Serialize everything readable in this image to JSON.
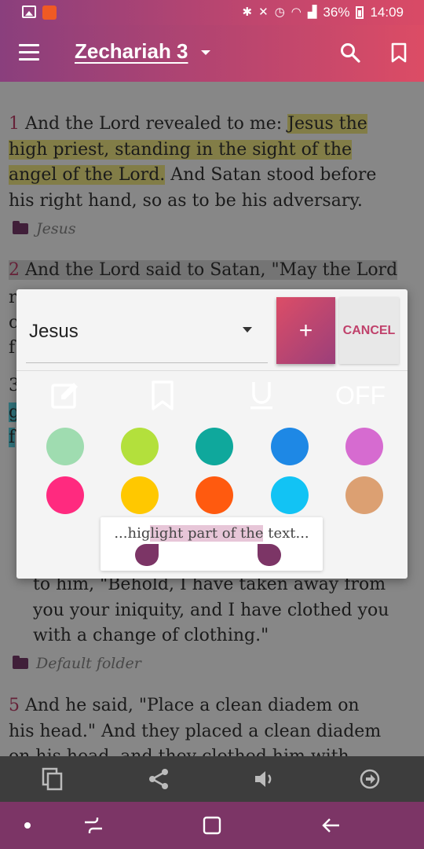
{
  "status_bar": {
    "battery": "36%",
    "time": "14:09"
  },
  "app_bar": {
    "title": "Zechariah 3"
  },
  "verses": [
    {
      "num": "1",
      "parts": [
        "And the Lord revealed to me: ",
        "Jesus the",
        "high priest, standing in the sight of the",
        "angel of the Lord.",
        " And Satan stood before",
        "his right hand, so as to be his adversary."
      ]
    },
    {
      "num": "2",
      "lines": [
        "And the Lord said to Satan, \"May the Lord"
      ]
    },
    {
      "num": "3"
    },
    {
      "lines": [
        "to him, \"Behold, I have taken away from",
        "you your iniquity, and I have clothed you",
        "with a change of clothing.\""
      ]
    },
    {
      "num": "5",
      "lines": [
        "And he said, \"Place a clean diadem on",
        "his head.\" And they placed a clean diadem",
        "on his head, and they clothed him with"
      ]
    }
  ],
  "folders": {
    "first": "Jesus",
    "second": "Default folder"
  },
  "fragments": {
    "r": "r",
    "c": "c",
    "f": "f",
    "g": "g",
    "f2": "f"
  },
  "popup": {
    "selected_folder": "Jesus",
    "add_label": "+",
    "cancel_label": "CANCEL",
    "off_label": "OFF",
    "preview_before": "...hig",
    "preview_highlight": "light part of the",
    "preview_after": " text...",
    "colors": [
      "#9fdcb0",
      "#b3e03c",
      "#0fa89c",
      "#1e88e5",
      "#d66bd0",
      "#ff2a7f",
      "#ffc800",
      "#ff5a0f",
      "#12c3f4",
      "#dca072"
    ]
  }
}
